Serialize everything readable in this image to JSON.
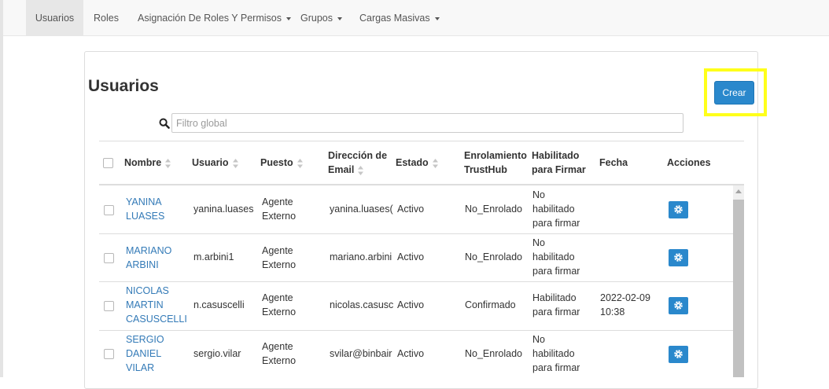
{
  "nav": {
    "tabs": [
      {
        "label": "Usuarios",
        "active": true
      },
      {
        "label": "Roles"
      },
      {
        "label": "Asignación De Roles Y Permisos",
        "dropdown": true
      },
      {
        "label": "Grupos",
        "dropdown": true
      },
      {
        "label": "Cargas Masivas",
        "dropdown": true
      }
    ]
  },
  "page": {
    "title": "Usuarios",
    "create_button": "Crear",
    "filter_placeholder": "Filtro global",
    "filter_value": ""
  },
  "table": {
    "headers": {
      "nombre": "Nombre",
      "usuario": "Usuario",
      "puesto": "Puesto",
      "email_1": "Dirección de",
      "email_2": "Email",
      "estado": "Estado",
      "enrol_1": "Enrolamiento",
      "enrol_2": "TrustHub",
      "habil_1": "Habilitado",
      "habil_2": "para Firmar",
      "fecha": "Fecha",
      "acciones": "Acciones"
    },
    "rows": [
      {
        "nombre": [
          "YANINA",
          "LUASES"
        ],
        "usuario": "yanina.luases",
        "puesto": [
          "Agente",
          "Externo"
        ],
        "email": "yanina.luases(",
        "estado": "Activo",
        "enrolamiento": "No_Enrolado",
        "habilitado": [
          "No",
          "habilitado",
          "para firmar"
        ],
        "fecha": [
          "",
          ""
        ]
      },
      {
        "nombre": [
          "MARIANO",
          "ARBINI"
        ],
        "usuario": "m.arbini1",
        "puesto": [
          "Agente",
          "Externo"
        ],
        "email": "mariano.arbini",
        "estado": "Activo",
        "enrolamiento": "No_Enrolado",
        "habilitado": [
          "No",
          "habilitado",
          "para firmar"
        ],
        "fecha": [
          "",
          ""
        ]
      },
      {
        "nombre": [
          "NICOLAS",
          "MARTIN",
          "CASUSCELLI"
        ],
        "usuario": "n.casuscelli",
        "puesto": [
          "Agente",
          "Externo"
        ],
        "email": "nicolas.casusc",
        "estado": "Activo",
        "enrolamiento": "Confirmado",
        "habilitado": [
          "Habilitado",
          "para firmar"
        ],
        "fecha": [
          "2022-02-09",
          "10:38"
        ]
      },
      {
        "nombre": [
          "SERGIO",
          "DANIEL",
          "VILAR"
        ],
        "usuario": "sergio.vilar",
        "puesto": [
          "Agente",
          "Externo"
        ],
        "email": "svilar@binbair",
        "estado": "Activo",
        "enrolamiento": "No_Enrolado",
        "habilitado": [
          "No",
          "habilitado",
          "para firmar"
        ],
        "fecha": [
          "",
          ""
        ]
      }
    ]
  },
  "icons": {
    "search": "search-icon",
    "sort": "sort-icon",
    "action": "gear-icon"
  },
  "colors": {
    "primary": "#2a88cc",
    "link": "#337ab7",
    "highlight": "#ffff1a"
  }
}
